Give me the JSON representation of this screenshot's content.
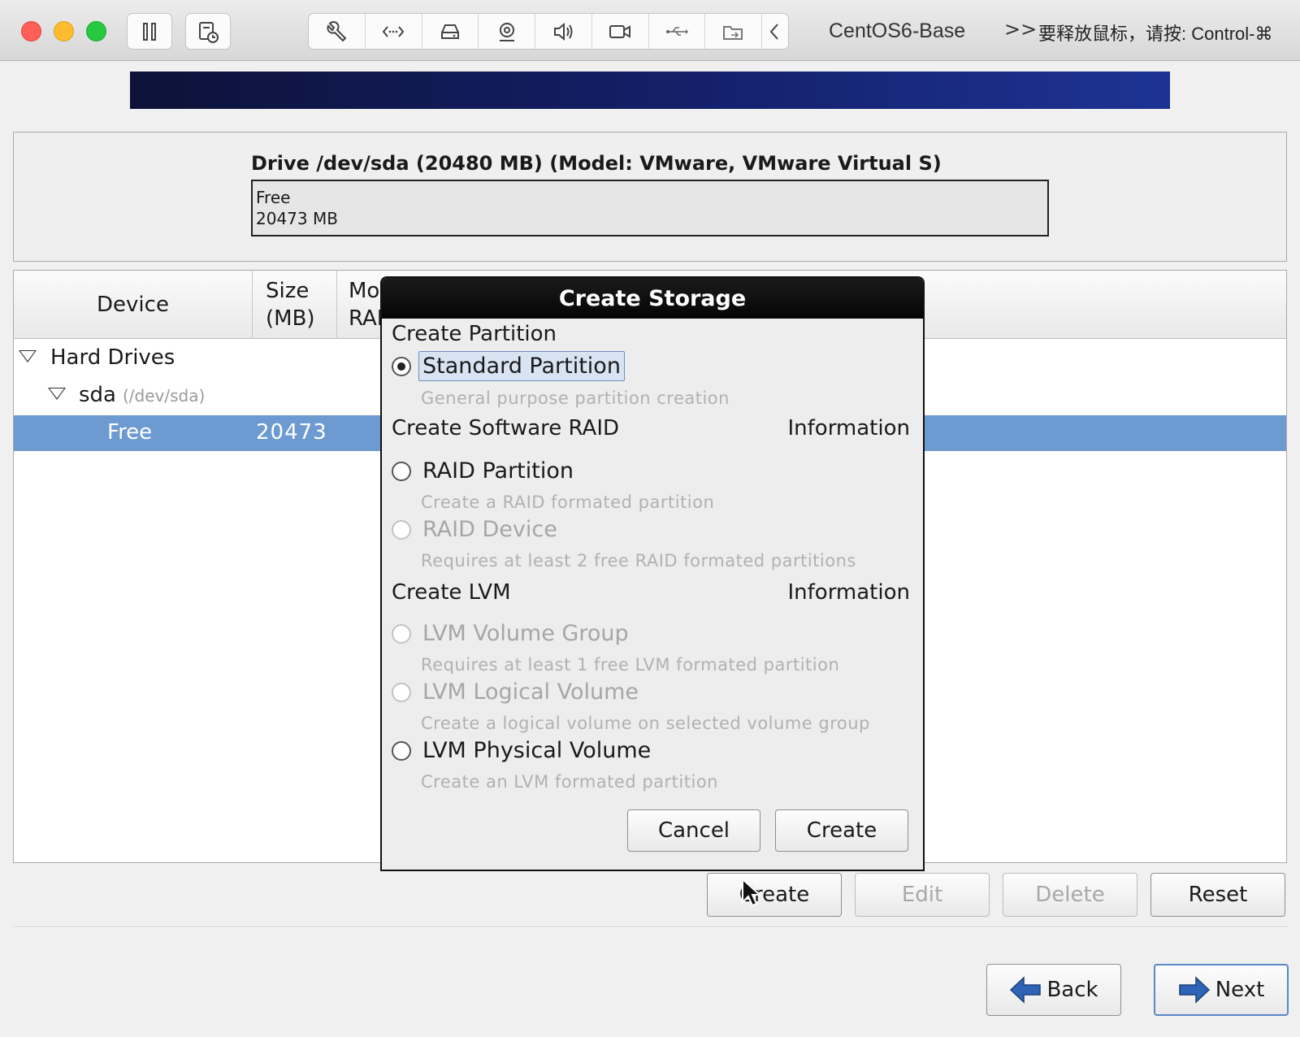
{
  "window": {
    "vm_name": "CentOS6-Base",
    "hint_chevron": ">>",
    "hint_text": "要释放鼠标，请按: Control-⌘",
    "toolbar_icons": [
      "pause-icon",
      "snapshot-icon",
      "wrench-icon",
      "code-icon",
      "hard-disk-icon",
      "webcam-icon",
      "speaker-icon",
      "camera-icon",
      "usb-icon",
      "shared-folder-icon",
      "chevron-left-icon"
    ]
  },
  "drive": {
    "title": "Drive /dev/sda (20480 MB) (Model: VMware, VMware Virtual S)",
    "free_label": "Free",
    "free_size": "20473 MB"
  },
  "table": {
    "headers": {
      "device": "Device",
      "size": "Size\n(MB)",
      "mount": "Mo\nRAI"
    },
    "rows": {
      "hard_drives": "Hard Drives",
      "sda": {
        "name": "sda",
        "path": "(/dev/sda)"
      },
      "free": {
        "name": "Free",
        "size": "20473"
      }
    }
  },
  "buttons": {
    "create": "Create",
    "edit": "Edit",
    "delete": "Delete",
    "reset": "Reset",
    "back": "Back",
    "next": "Next"
  },
  "dialog": {
    "title": "Create Storage",
    "section_partition": "Create Partition",
    "standard_partition": {
      "label": "Standard Partition",
      "desc": "General purpose partition creation",
      "checked": true
    },
    "section_raid": "Create Software RAID",
    "raid_info": "Information",
    "raid_partition": {
      "label": "RAID Partition",
      "desc": "Create a RAID formated partition"
    },
    "raid_device": {
      "label": "RAID Device",
      "desc": "Requires at least 2 free RAID formated partitions"
    },
    "section_lvm": "Create LVM",
    "lvm_info": "Information",
    "lvm_vg": {
      "label": "LVM Volume Group",
      "desc": "Requires at least 1 free LVM formated partition"
    },
    "lvm_lv": {
      "label": "LVM Logical Volume",
      "desc": "Create a logical volume on selected volume group"
    },
    "lvm_pv": {
      "label": "LVM Physical Volume",
      "desc": "Create an LVM formated partition"
    },
    "cancel": "Cancel",
    "create": "Create"
  },
  "colors": {
    "selection": "#6d9ad1",
    "banner_start": "#0d1238",
    "banner_end": "#1d3394",
    "arrow": "#2e63b5"
  }
}
